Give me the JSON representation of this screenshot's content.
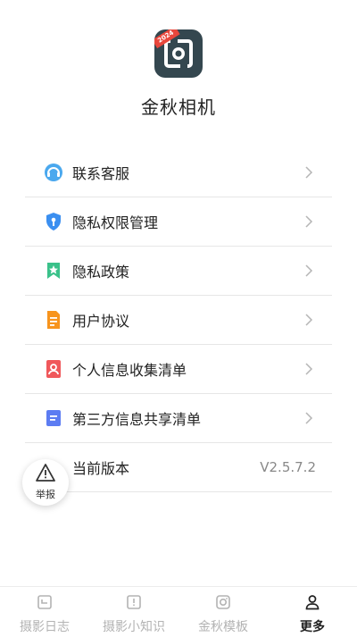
{
  "app": {
    "name": "金秋相机",
    "logo_badge": "2024"
  },
  "menu": {
    "items": [
      {
        "label": "联系客服",
        "icon": "customer-service-icon"
      },
      {
        "label": "隐私权限管理",
        "icon": "privacy-shield-icon"
      },
      {
        "label": "隐私政策",
        "icon": "bookmark-star-icon"
      },
      {
        "label": "用户协议",
        "icon": "document-icon"
      },
      {
        "label": "个人信息收集清单",
        "icon": "person-card-icon"
      },
      {
        "label": "第三方信息共享清单",
        "icon": "list-doc-icon"
      },
      {
        "label": "当前版本",
        "value": "V2.5.7.2"
      }
    ]
  },
  "report_button": {
    "label": "举报",
    "icon": "warning-icon"
  },
  "tabbar": {
    "tabs": [
      {
        "label": "摄影日志",
        "icon": "log-icon",
        "active": false
      },
      {
        "label": "摄影小知识",
        "icon": "tips-icon",
        "active": false
      },
      {
        "label": "金秋模板",
        "icon": "camera-template-icon",
        "active": false
      },
      {
        "label": "更多",
        "icon": "person-icon",
        "active": true
      }
    ]
  },
  "colors": {
    "logo_bg": "#34474f",
    "badge": "#e8473c",
    "divider": "#e6e6e6",
    "inactive_tab": "#b3b3b3"
  }
}
